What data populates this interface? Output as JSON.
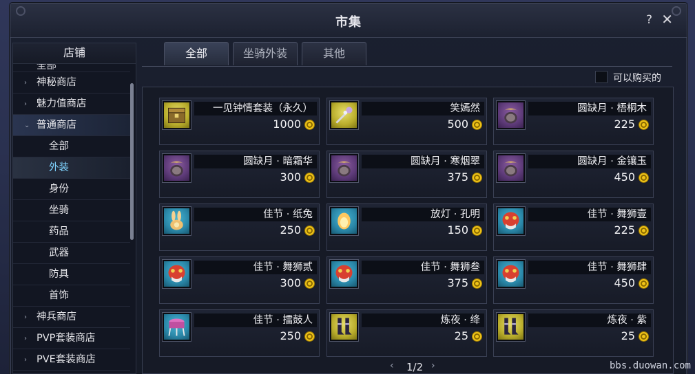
{
  "window": {
    "title": "市集",
    "help_icon": "?",
    "close_icon": "✕"
  },
  "sidebar": {
    "header": "店铺",
    "cut_item": "全部",
    "items": [
      {
        "label": "神秘商店",
        "chevron": "›",
        "kind": "category"
      },
      {
        "label": "魅力值商店",
        "chevron": "›",
        "kind": "category"
      },
      {
        "label": "普通商店",
        "chevron": "⌄",
        "kind": "category-open"
      },
      {
        "label": "全部",
        "kind": "sub"
      },
      {
        "label": "外装",
        "kind": "sub-selected"
      },
      {
        "label": "身份",
        "kind": "sub"
      },
      {
        "label": "坐骑",
        "kind": "sub"
      },
      {
        "label": "药品",
        "kind": "sub"
      },
      {
        "label": "武器",
        "kind": "sub"
      },
      {
        "label": "防具",
        "kind": "sub"
      },
      {
        "label": "首饰",
        "kind": "sub"
      },
      {
        "label": "神兵商店",
        "chevron": "›",
        "kind": "category"
      },
      {
        "label": "PVP套装商店",
        "chevron": "›",
        "kind": "category"
      },
      {
        "label": "PVE套装商店",
        "chevron": "›",
        "kind": "category"
      }
    ]
  },
  "tabs": [
    {
      "label": "全部",
      "active": true
    },
    {
      "label": "坐骑外装",
      "active": false
    },
    {
      "label": "其他",
      "active": false
    }
  ],
  "filter": {
    "label": "可以购买的",
    "checked": false
  },
  "items": [
    {
      "name": "一见钟情套装（永久）",
      "price": "1000",
      "icon": "chest-icon",
      "bg": "gold"
    },
    {
      "name": "笑嫣然",
      "price": "500",
      "icon": "hairpin-icon",
      "bg": "gold"
    },
    {
      "name": "圆缺月 · 梧桐木",
      "price": "225",
      "icon": "crescent-mask-icon",
      "bg": "purple"
    },
    {
      "name": "圆缺月 · 暗霜华",
      "price": "300",
      "icon": "crescent-mask-icon",
      "bg": "purple"
    },
    {
      "name": "圆缺月 · 寒烟翠",
      "price": "375",
      "icon": "crescent-mask-icon",
      "bg": "purple"
    },
    {
      "name": "圆缺月 · 金镶玉",
      "price": "450",
      "icon": "crescent-mask-icon",
      "bg": "purple"
    },
    {
      "name": "佳节 · 纸兔",
      "price": "250",
      "icon": "paper-rabbit-icon",
      "bg": "teal"
    },
    {
      "name": "放灯 · 孔明",
      "price": "150",
      "icon": "sky-lantern-icon",
      "bg": "teal"
    },
    {
      "name": "佳节 · 舞狮壹",
      "price": "225",
      "icon": "lion-mask-icon",
      "bg": "teal"
    },
    {
      "name": "佳节 · 舞狮贰",
      "price": "300",
      "icon": "lion-mask-icon",
      "bg": "teal"
    },
    {
      "name": "佳节 · 舞狮叁",
      "price": "375",
      "icon": "lion-mask-icon",
      "bg": "teal"
    },
    {
      "name": "佳节 · 舞狮肆",
      "price": "450",
      "icon": "lion-mask-icon",
      "bg": "teal"
    },
    {
      "name": "佳节 · 擂鼓人",
      "price": "250",
      "icon": "drum-icon",
      "bg": "teal"
    },
    {
      "name": "炼夜 · 绛",
      "price": "25",
      "icon": "boots-icon",
      "bg": "gold"
    },
    {
      "name": "炼夜 · 紫",
      "price": "25",
      "icon": "boots-icon",
      "bg": "gold"
    }
  ],
  "pager": {
    "prev": "‹",
    "text": "1/2",
    "next": "›"
  },
  "site_mark": "bbs.duowan.com"
}
